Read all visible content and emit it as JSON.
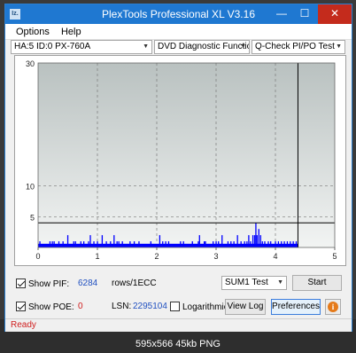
{
  "window": {
    "title": "PlexTools Professional XL V3.16",
    "app_icon": "Iz.",
    "minimize_glyph": "—",
    "maximize_glyph": "☐",
    "close_glyph": "✕"
  },
  "menu": {
    "items": [
      "Options",
      "Help"
    ]
  },
  "toolbar": {
    "drive": "HA:5 ID:0  PX-760A",
    "function": "DVD Diagnostic Functions",
    "test": "Q-Check PI/PO Test"
  },
  "chart_data": {
    "type": "bar",
    "y_ticks": [
      "30",
      "10",
      "5"
    ],
    "x_ticks": [
      "0",
      "1",
      "2",
      "3",
      "4",
      "5"
    ],
    "xlim": [
      0,
      5
    ],
    "ylim": [
      0,
      30
    ],
    "threshold_line": 4,
    "end_marker_x": 4.38,
    "series": [
      {
        "name": "PIF",
        "color": "#0000ff",
        "points": [
          [
            0.03,
            1
          ],
          [
            0.2,
            1
          ],
          [
            0.24,
            1
          ],
          [
            0.27,
            1
          ],
          [
            0.35,
            1
          ],
          [
            0.42,
            1
          ],
          [
            0.5,
            2
          ],
          [
            0.6,
            1
          ],
          [
            0.63,
            1
          ],
          [
            0.72,
            1
          ],
          [
            0.77,
            1
          ],
          [
            0.85,
            1
          ],
          [
            0.88,
            2
          ],
          [
            0.94,
            1
          ],
          [
            1.0,
            1
          ],
          [
            1.08,
            2
          ],
          [
            1.15,
            1
          ],
          [
            1.22,
            1
          ],
          [
            1.28,
            2
          ],
          [
            1.33,
            1
          ],
          [
            1.36,
            1
          ],
          [
            1.42,
            1
          ],
          [
            1.55,
            1
          ],
          [
            1.62,
            1
          ],
          [
            1.7,
            1
          ],
          [
            1.9,
            1
          ],
          [
            2.05,
            2
          ],
          [
            2.1,
            1
          ],
          [
            2.15,
            1
          ],
          [
            2.2,
            1
          ],
          [
            2.4,
            1
          ],
          [
            2.45,
            1
          ],
          [
            2.6,
            1
          ],
          [
            2.7,
            1
          ],
          [
            2.72,
            2
          ],
          [
            2.8,
            1
          ],
          [
            2.82,
            1
          ],
          [
            2.95,
            1
          ],
          [
            3.0,
            1
          ],
          [
            3.04,
            1
          ],
          [
            3.1,
            2
          ],
          [
            3.2,
            1
          ],
          [
            3.25,
            1
          ],
          [
            3.3,
            1
          ],
          [
            3.36,
            2
          ],
          [
            3.42,
            1
          ],
          [
            3.48,
            1
          ],
          [
            3.52,
            1
          ],
          [
            3.55,
            2
          ],
          [
            3.58,
            1
          ],
          [
            3.62,
            2
          ],
          [
            3.65,
            2
          ],
          [
            3.67,
            4
          ],
          [
            3.69,
            2
          ],
          [
            3.72,
            3
          ],
          [
            3.75,
            2
          ],
          [
            3.78,
            1
          ],
          [
            3.82,
            1
          ],
          [
            3.88,
            1
          ],
          [
            3.92,
            1
          ],
          [
            4.0,
            1
          ],
          [
            4.05,
            1
          ],
          [
            4.1,
            1
          ],
          [
            4.15,
            1
          ],
          [
            4.2,
            1
          ],
          [
            4.25,
            1
          ],
          [
            4.3,
            1
          ],
          [
            4.35,
            1
          ]
        ]
      }
    ]
  },
  "controls": {
    "show_pif_label": "Show PIF:",
    "pif_value": "6284",
    "pif_unit": "rows/1ECC",
    "show_poe_label": "Show POE:",
    "poe_value": "0",
    "lsn_label": "LSN:",
    "lsn_value": "2295104",
    "logarithmic_label": "Logarithmic",
    "mode_select": "SUM1 Test",
    "start_button": "Start",
    "view_log_button": "View Log",
    "preferences_button": "Preferences",
    "info_glyph": "i"
  },
  "status": {
    "text": "Ready"
  },
  "caption": "595x566  45kb  PNG"
}
